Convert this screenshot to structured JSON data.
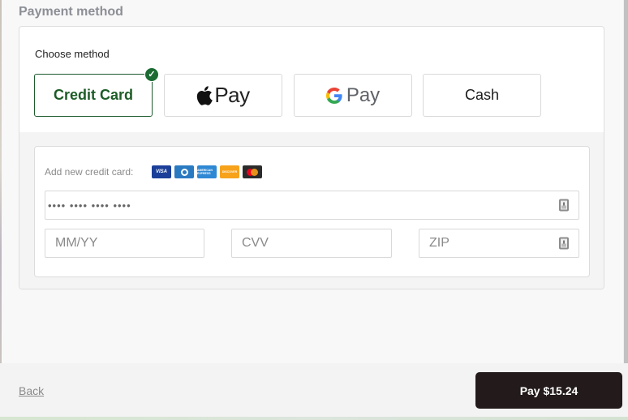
{
  "section": {
    "title": "Payment method"
  },
  "chooser": {
    "label": "Choose method",
    "methods": [
      {
        "id": "credit-card",
        "label": "Credit Card",
        "selected": true,
        "selected_icon": "checkmark-icon",
        "check_glyph": "✓"
      },
      {
        "id": "apple-pay",
        "label": "Pay",
        "brand_icon": "apple-logo-icon",
        "selected": false
      },
      {
        "id": "google-pay",
        "label": "Pay",
        "brand_icon": "google-g-logo-icon",
        "selected": false
      },
      {
        "id": "cash",
        "label": "Cash",
        "selected": false
      }
    ]
  },
  "card_form": {
    "add_label": "Add new credit card:",
    "brands": [
      {
        "name": "visa",
        "label": "VISA"
      },
      {
        "name": "diners-club",
        "label": ""
      },
      {
        "name": "american-express",
        "label": "AMERICAN EXPRESS"
      },
      {
        "name": "discover",
        "label": "DISCOVER"
      },
      {
        "name": "mastercard",
        "label": ""
      }
    ],
    "card_number": {
      "value": "•••• •••• •••• ••••",
      "icon": "autofill-contact-icon"
    },
    "expiry": {
      "placeholder": "MM/YY",
      "value": ""
    },
    "cvv": {
      "placeholder": "CVV",
      "value": ""
    },
    "zip": {
      "placeholder": "ZIP",
      "value": "",
      "icon": "autofill-contact-icon"
    }
  },
  "footer": {
    "back_label": "Back",
    "pay_label": "Pay $15.24"
  },
  "colors": {
    "accent_green": "#1d5c27",
    "pay_button_bg": "#231a1b",
    "section_title": "#8d8f96"
  }
}
